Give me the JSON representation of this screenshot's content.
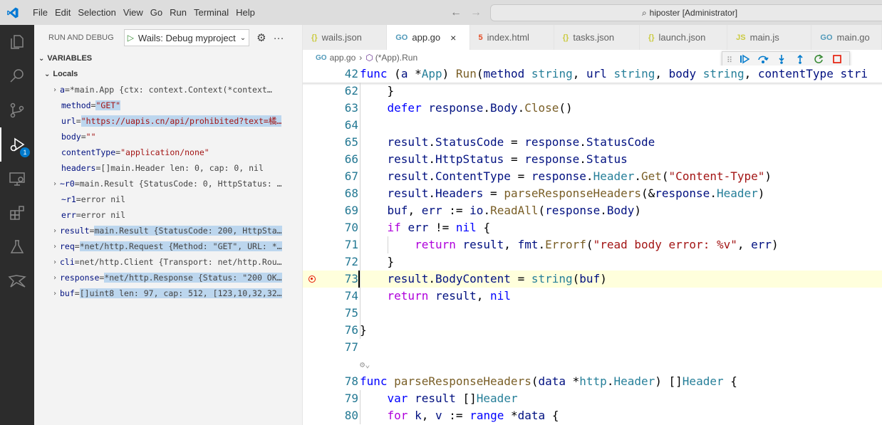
{
  "titlebar": {
    "menu": [
      "File",
      "Edit",
      "Selection",
      "View",
      "Go",
      "Run",
      "Terminal",
      "Help"
    ],
    "search": "hiposter [Administrator]"
  },
  "activity": {
    "icons": [
      "explorer-icon",
      "search-icon",
      "source-control-icon",
      "run-debug-icon",
      "remote-explorer-icon",
      "extensions-icon",
      "testing-icon",
      "wails-icon"
    ],
    "debug_badge": "1"
  },
  "sidebar": {
    "header": "RUN AND DEBUG",
    "config": "Wails: Debug myproject",
    "variables_title": "VARIABLES",
    "locals_title": "Locals",
    "vars": [
      {
        "expand": true,
        "name": "a",
        "value": "*main.App {ctx: context.Context(*context.valueCtx) *{Context:…",
        "kind": "plain",
        "hl": false
      },
      {
        "expand": false,
        "name": "method",
        "value": "\"GET\"",
        "kind": "str",
        "hl": true
      },
      {
        "expand": false,
        "name": "url",
        "value": "\"https://uapis.cn/api/prohibited?text=橘…",
        "kind": "str",
        "hl": true
      },
      {
        "expand": false,
        "name": "body",
        "value": "\"\"",
        "kind": "str",
        "hl": false
      },
      {
        "expand": false,
        "name": "contentType",
        "value": "\"application/none\"",
        "kind": "str",
        "hl": false
      },
      {
        "expand": false,
        "name": "headers",
        "value": "[]main.Header len: 0, cap: 0, nil",
        "kind": "plain",
        "hl": false
      },
      {
        "expand": true,
        "name": "~r0",
        "value": "main.Result {StatusCode: 0, HttpStatus: …",
        "kind": "plain",
        "hl": false
      },
      {
        "expand": false,
        "name": "~r1",
        "value": "error nil",
        "kind": "plain",
        "hl": false
      },
      {
        "expand": false,
        "name": "err",
        "value": "error nil",
        "kind": "plain",
        "hl": false
      },
      {
        "expand": true,
        "name": "result",
        "value": "main.Result {StatusCode: 200, HttpSta…",
        "kind": "plain",
        "hl": true
      },
      {
        "expand": true,
        "name": "req",
        "value": "*net/http.Request {Method: \"GET\", URL: *…",
        "kind": "plain",
        "hl": true
      },
      {
        "expand": true,
        "name": "cli",
        "value": "net/http.Client {Transport: net/http.Rou…",
        "kind": "plain",
        "hl": false
      },
      {
        "expand": true,
        "name": "response",
        "value": "*net/http.Response {Status: \"200 OK…",
        "kind": "plain",
        "hl": true
      },
      {
        "expand": true,
        "name": "buf",
        "value": "[]uint8 len: 97, cap: 512, [123,10,32,32…",
        "kind": "plain",
        "hl": true
      }
    ]
  },
  "tabs": [
    {
      "label": "wails.json",
      "icon": "{}",
      "type": "json",
      "active": false
    },
    {
      "label": "app.go",
      "icon": "GO",
      "type": "go",
      "active": true
    },
    {
      "label": "index.html",
      "icon": "5",
      "type": "html",
      "active": false
    },
    {
      "label": "tasks.json",
      "icon": "{}",
      "type": "json",
      "active": false
    },
    {
      "label": "launch.json",
      "icon": "{}",
      "type": "json",
      "active": false
    },
    {
      "label": "main.js",
      "icon": "JS",
      "type": "js",
      "active": false
    },
    {
      "label": "main.go",
      "icon": "GO",
      "type": "go",
      "active": false
    }
  ],
  "breadcrumb": {
    "file": "app.go",
    "symbol": "(*App).Run"
  },
  "editor": {
    "current_line": 73,
    "breakpoint_line": 73,
    "lines": [
      {
        "n": "42",
        "code": "func (a *App) Run(method string, url string, body string, contentType stri",
        "sticky": true
      },
      {
        "n": "62",
        "code": "    }"
      },
      {
        "n": "63",
        "code": "    defer response.Body.Close()"
      },
      {
        "n": "64",
        "code": ""
      },
      {
        "n": "65",
        "code": "    result.StatusCode = response.StatusCode"
      },
      {
        "n": "66",
        "code": "    result.HttpStatus = response.Status"
      },
      {
        "n": "67",
        "code": "    result.ContentType = response.Header.Get(\"Content-Type\")"
      },
      {
        "n": "68",
        "code": "    result.Headers = parseResponseHeaders(&response.Header)"
      },
      {
        "n": "69",
        "code": "    buf, err := io.ReadAll(response.Body)"
      },
      {
        "n": "70",
        "code": "    if err != nil {"
      },
      {
        "n": "71",
        "code": "        return result, fmt.Errorf(\"read body error: %v\", err)"
      },
      {
        "n": "72",
        "code": "    }"
      },
      {
        "n": "73",
        "code": "    result.BodyContent = string(buf)"
      },
      {
        "n": "74",
        "code": "    return result, nil"
      },
      {
        "n": "75",
        "code": ""
      },
      {
        "n": "76",
        "code": "}"
      },
      {
        "n": "77",
        "code": ""
      },
      {
        "n": "",
        "code": "",
        "lens": true
      },
      {
        "n": "78",
        "code": "func parseResponseHeaders(data *http.Header) []Header {"
      },
      {
        "n": "79",
        "code": "    var result []Header"
      },
      {
        "n": "80",
        "code": "    for k, v := range *data {"
      }
    ]
  }
}
